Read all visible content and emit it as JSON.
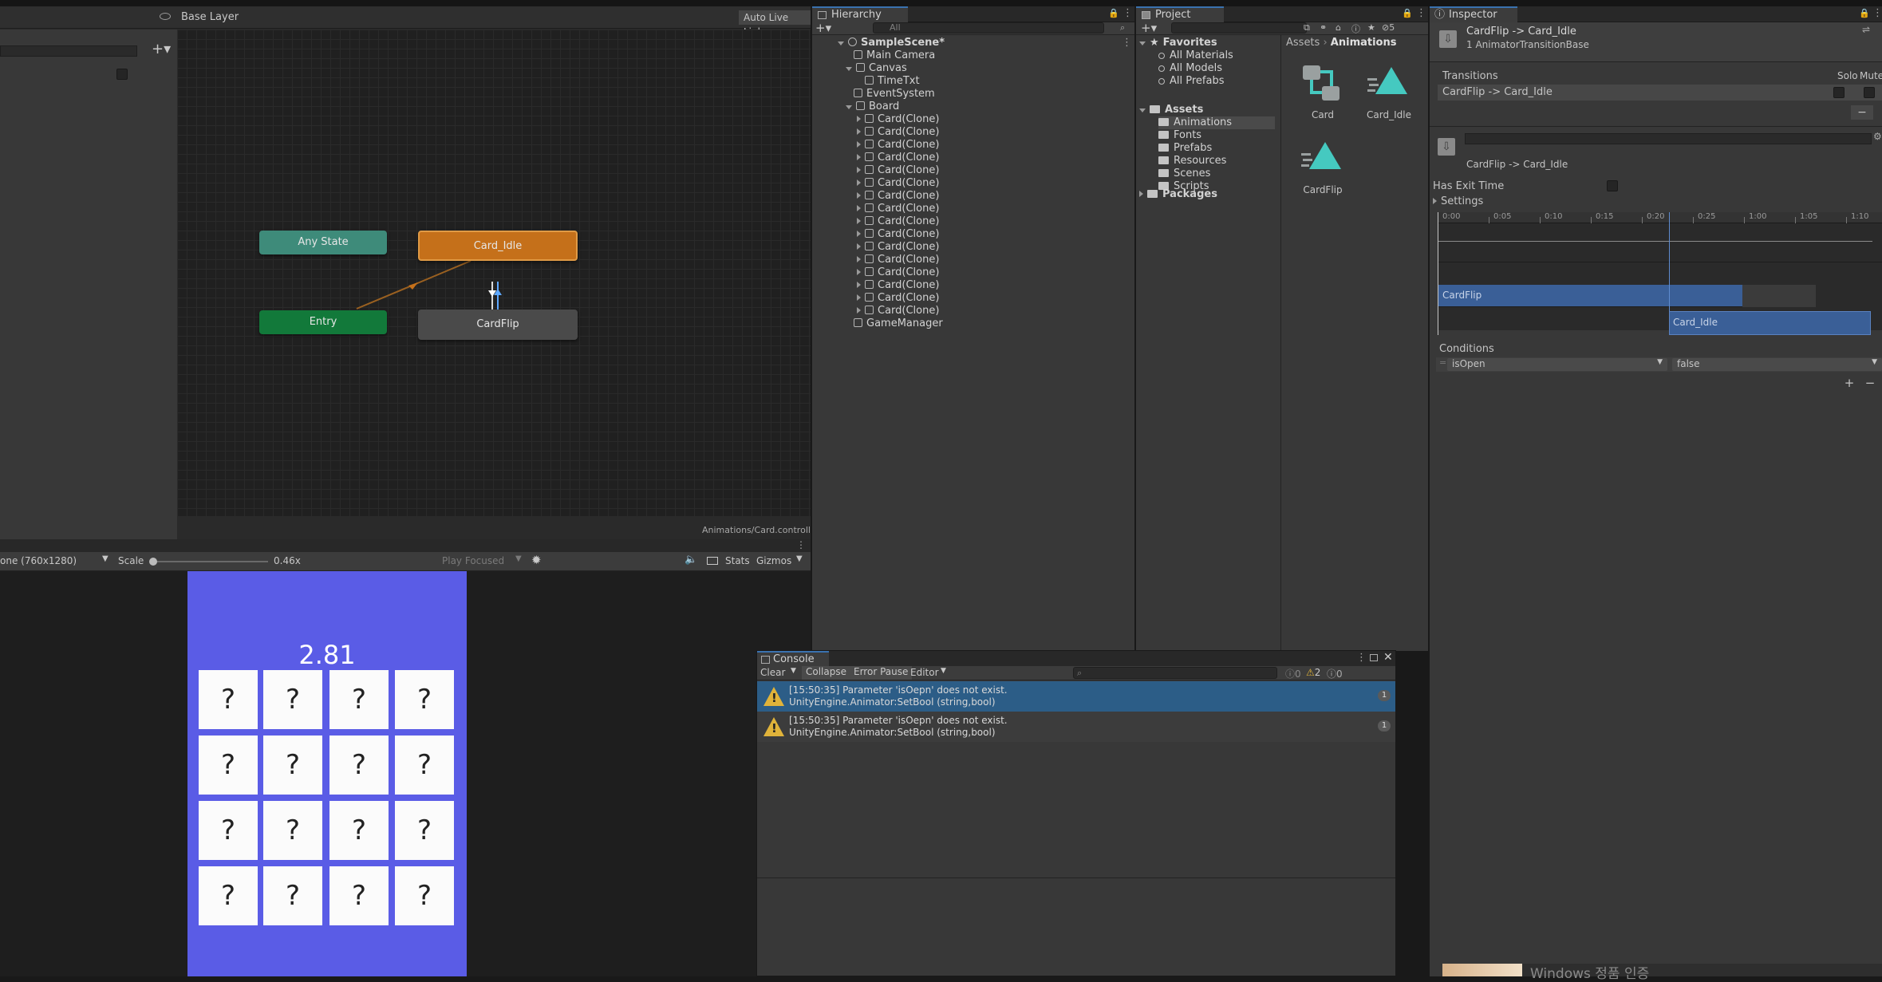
{
  "animator": {
    "layer": "Base Layer",
    "live_link": "Auto Live Link",
    "path": "Animations/Card.controller",
    "nodes": {
      "any_state": "Any State",
      "card_idle": "Card_Idle",
      "entry": "Entry",
      "card_flip": "CardFlip"
    },
    "colors": {
      "any_state": "#3e8b7a",
      "card_idle": "#c5701a",
      "entry": "#12793a",
      "card_flip": "#4a4a4a"
    }
  },
  "game": {
    "resolution": "one (760x1280)",
    "scale_label": "Scale",
    "scale_value": "0.46x",
    "play_mode": "Play Focused",
    "stats": "Stats",
    "gizmos": "Gizmos",
    "score": "2.81",
    "card_symbol": "?",
    "bg_color": "#5a5ce6"
  },
  "hierarchy": {
    "tab": "Hierarchy",
    "search_placeholder": "All",
    "scene": "SampleScene*",
    "items": [
      "Main Camera",
      "Canvas",
      "TimeTxt",
      "EventSystem",
      "Board",
      "Card(Clone)",
      "Card(Clone)",
      "Card(Clone)",
      "Card(Clone)",
      "Card(Clone)",
      "Card(Clone)",
      "Card(Clone)",
      "Card(Clone)",
      "Card(Clone)",
      "Card(Clone)",
      "Card(Clone)",
      "Card(Clone)",
      "Card(Clone)",
      "Card(Clone)",
      "Card(Clone)",
      "Card(Clone)",
      "GameManager"
    ]
  },
  "project": {
    "tab": "Project",
    "hidden_count": "5",
    "favorites_label": "Favorites",
    "favorites": [
      "All Materials",
      "All Models",
      "All Prefabs"
    ],
    "assets_label": "Assets",
    "asset_folders": [
      "Animations",
      "Fonts",
      "Prefabs",
      "Resources",
      "Scenes",
      "Scripts"
    ],
    "packages_label": "Packages",
    "breadcrumb": [
      "Assets",
      "Animations"
    ],
    "files": [
      "Card",
      "Card_Idle",
      "CardFlip"
    ]
  },
  "console": {
    "tab": "Console",
    "clear": "Clear",
    "collapse": "Collapse",
    "error_pause": "Error Pause",
    "editor": "Editor",
    "count_log": "0",
    "count_warn": "2",
    "count_err": "0",
    "messages": [
      {
        "line1": "[15:50:35] Parameter 'isOepn' does not exist.",
        "line2": "UnityEngine.Animator:SetBool (string,bool)",
        "count": "1"
      },
      {
        "line1": "[15:50:35] Parameter 'isOepn' does not exist.",
        "line2": "UnityEngine.Animator:SetBool (string,bool)",
        "count": "1"
      }
    ]
  },
  "inspector": {
    "tab": "Inspector",
    "title": "CardFlip -> Card_Idle",
    "subtitle": "1 AnimatorTransitionBase",
    "transitions_label": "Transitions",
    "solo": "Solo",
    "mute": "Mute",
    "transition_item": "CardFlip -> Card_Idle",
    "detail_title": "CardFlip -> Card_Idle",
    "has_exit_time": "Has Exit Time",
    "settings": "Settings",
    "timeline_ticks": [
      "0:00",
      "0:05",
      "0:10",
      "0:15",
      "0:20",
      "0:25",
      "1:00",
      "1:05",
      "1:10"
    ],
    "clip_from": "CardFlip",
    "clip_to": "Card_Idle",
    "conditions_label": "Conditions",
    "condition_param": "isOpen",
    "condition_value": "false",
    "taskbar_text": "Windows 정품 인증"
  }
}
